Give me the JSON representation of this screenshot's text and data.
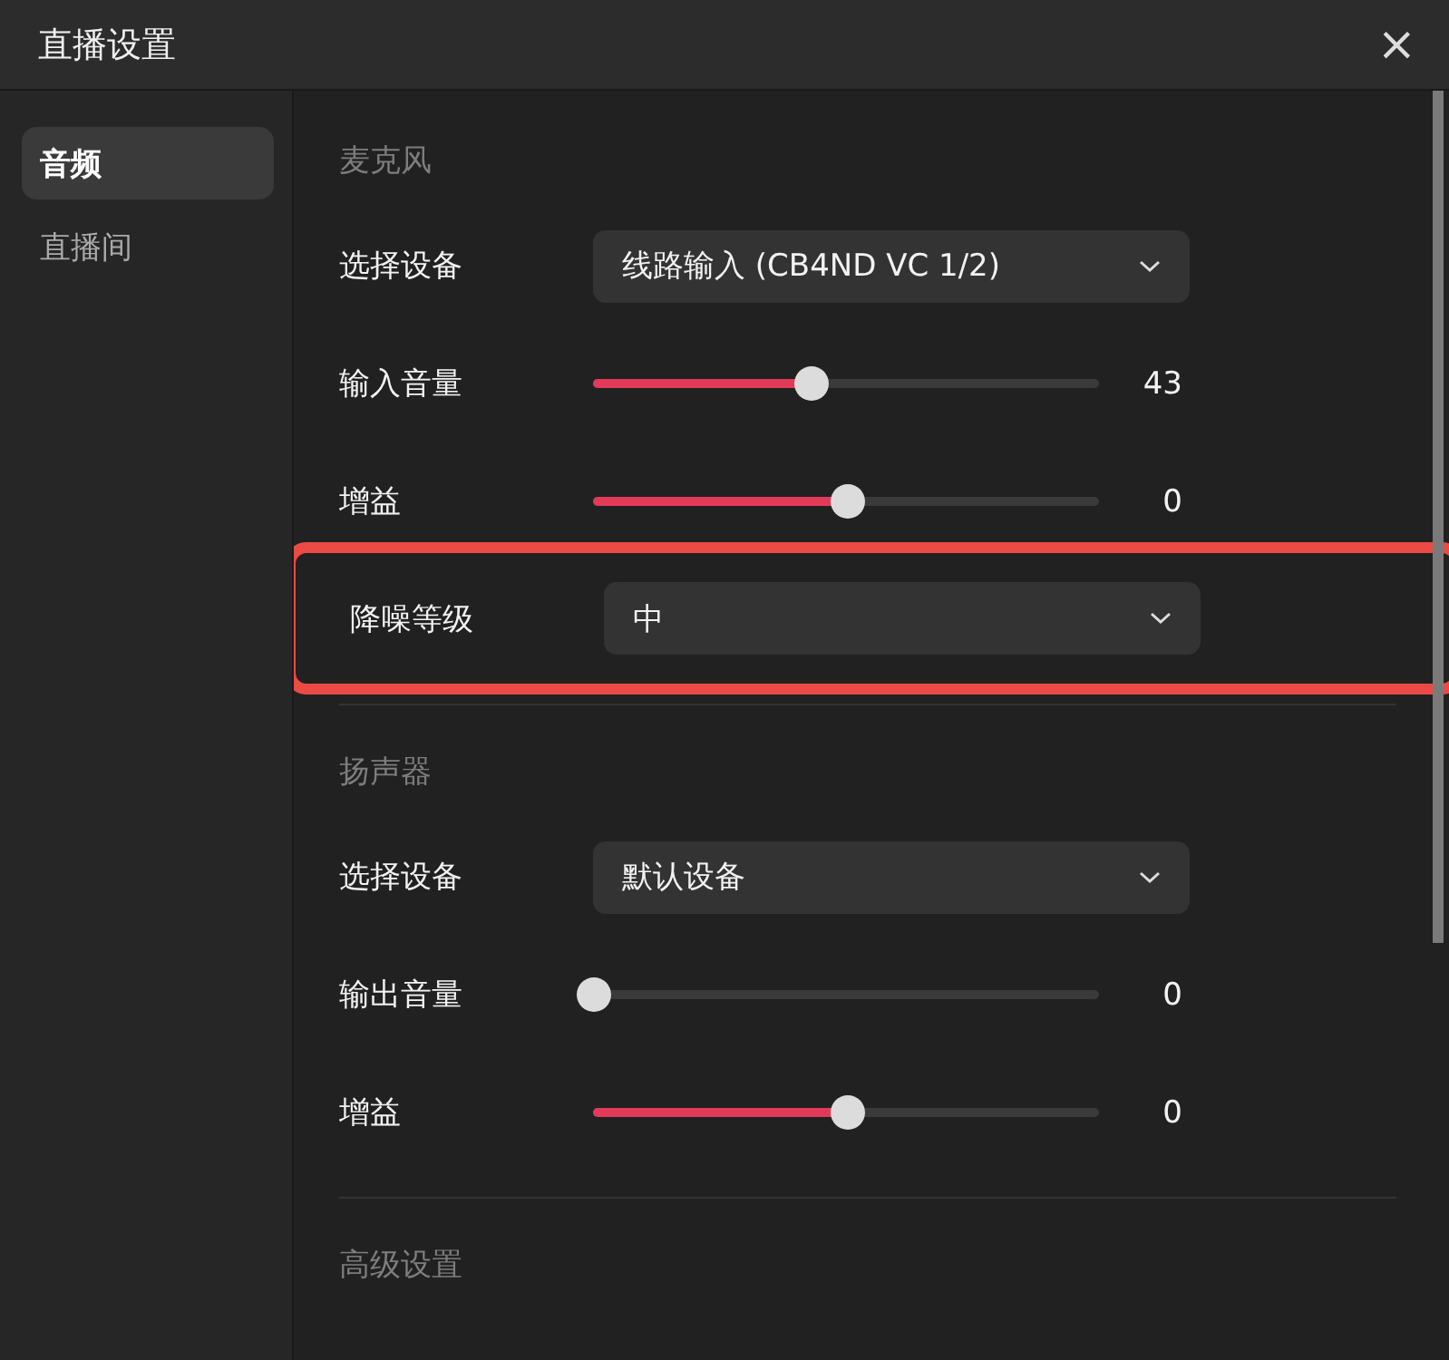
{
  "window": {
    "title": "直播设置",
    "close": "×"
  },
  "sidebar": {
    "items": [
      {
        "label": "音频",
        "selected": true
      },
      {
        "label": "直播间",
        "selected": false
      }
    ]
  },
  "sections": [
    {
      "heading": "麦克风",
      "rows": [
        {
          "kind": "dropdown",
          "label": "选择设备",
          "value": "线路输入 (CB4ND VC 1/2)",
          "highlighted": false
        },
        {
          "kind": "slider",
          "label": "输入音量",
          "level": 0.43,
          "reading": "43",
          "highlighted": false
        },
        {
          "kind": "slider",
          "label": "增益",
          "level": 0.5,
          "reading": "0",
          "highlighted": false
        },
        {
          "kind": "dropdown",
          "label": "降噪等级",
          "value": "中",
          "highlighted": true
        }
      ]
    },
    {
      "heading": "扬声器",
      "rows": [
        {
          "kind": "dropdown",
          "label": "选择设备",
          "value": "默认设备",
          "highlighted": false
        },
        {
          "kind": "slider",
          "label": "输出音量",
          "level": 0,
          "reading": "0",
          "highlighted": false
        },
        {
          "kind": "slider",
          "label": "增益",
          "level": 0.5,
          "reading": "0",
          "highlighted": false
        }
      ]
    },
    {
      "heading": "高级设置"
    }
  ]
}
